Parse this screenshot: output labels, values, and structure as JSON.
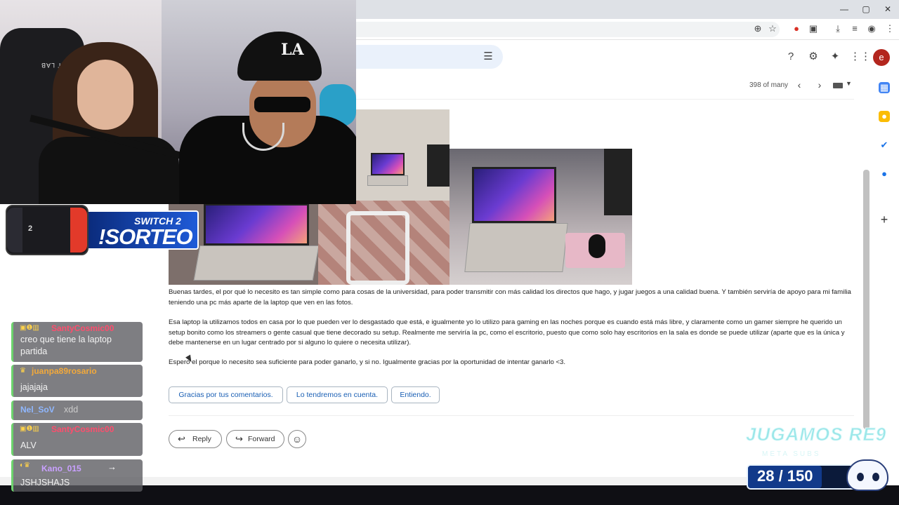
{
  "browser": {
    "window_controls": [
      "—",
      "▢",
      "✕"
    ],
    "toolbar_icons": [
      "zoom-icon",
      "star-icon",
      "extension-red-icon",
      "puzzle-icon",
      "download-icon",
      "reading-list-icon",
      "profile-icon",
      "menu-icon"
    ]
  },
  "gmail": {
    "header_icons": [
      "filter-icon",
      "help-icon",
      "settings-icon",
      "gemini-icon",
      "apps-icon"
    ],
    "avatar_letter": "e",
    "pagination": "398 of many",
    "side_panel_icons": [
      "calendar-icon",
      "keep-icon",
      "tasks-icon",
      "contacts-icon",
      "add-icon"
    ],
    "body_paragraphs": [
      "Buenas tardes, el por qué lo necesito es tan simple como para cosas de la universidad, para poder transmitir con más calidad los directos que hago, y jugar juegos a una calidad buena. Y también serviría de apoyo para mi familia teniendo una pc más aparte de la laptop que ven en las fotos.",
      "Esa laptop la utilizamos todos en casa por lo que pueden ver lo desgastado que está, e igualmente yo lo utilizo para gaming en las noches porque es cuando está más libre, y claramente como un gamer siempre he querido un setup bonito como los streamers o gente casual que tiene decorado su setup. Realmente me serviría la pc, como el escritorio, puesto que como solo hay escritorios en la sala es donde se puede utilizar (aparte que es la única y debe mantenerse en un lugar centrado por si alguno lo quiere o necesita utilizar).",
      "Espero el porque lo necesito sea suficiente para poder ganarlo, y si no. Igualmente gracias por la oportunidad de intentar ganarlo <3."
    ],
    "smart_replies": [
      "Gracias por tus comentarios.",
      "Lo tendremos en cuenta.",
      "Entiendo."
    ],
    "actions": {
      "reply": "Reply",
      "forward": "Forward"
    }
  },
  "stream": {
    "chair_label": "SECRET LAB",
    "cap_logo": "LA",
    "banner": {
      "title": "SWITCH 2",
      "subtitle": "!SORTEO",
      "console_badge": "2"
    },
    "chat": [
      {
        "user": "SantyCosmic00",
        "color": "#ff4d6d",
        "text": "creo que tiene la laptop partida"
      },
      {
        "user": "juanpa89rosario",
        "color": "#f2a93b",
        "text": "jajajaja"
      },
      {
        "user": "Nel_SoV",
        "color": "#8fb7ff",
        "text": "xdd"
      },
      {
        "user": "SantyCosmic00",
        "color": "#ff4d6d",
        "text": "ALV"
      },
      {
        "user": "Kano_015",
        "color": "#c9a0ff",
        "text": "JSHJSHAJS"
      }
    ],
    "goal": {
      "title": "JUGAMOS RE9",
      "subtitle": "META SUBS",
      "current": 28,
      "target": 150,
      "text": "28 / 150",
      "progress": 0.187
    }
  }
}
